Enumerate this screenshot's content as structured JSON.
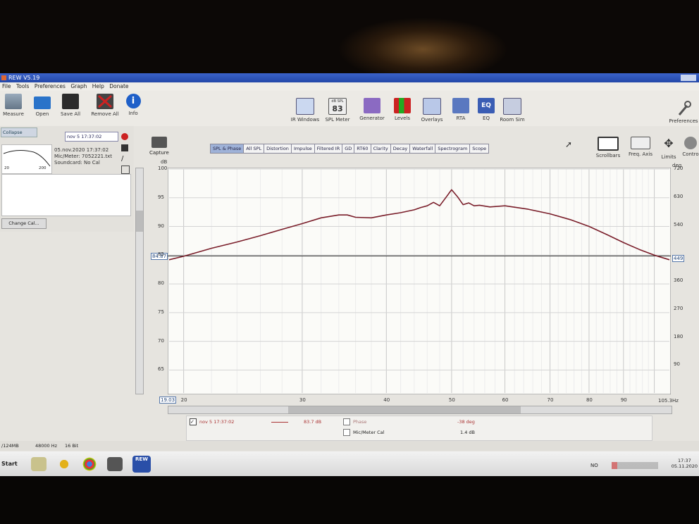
{
  "window": {
    "title": "REW V5.19"
  },
  "menu": [
    "File",
    "Tools",
    "Preferences",
    "Graph",
    "Help",
    "Donate"
  ],
  "toolbar_left": [
    {
      "label": "Measure",
      "icon": "measure-icon"
    },
    {
      "label": "Open",
      "icon": "folder-icon"
    },
    {
      "label": "Save All",
      "icon": "save-icon"
    },
    {
      "label": "Remove All",
      "icon": "remove-icon"
    },
    {
      "label": "Info",
      "icon": "info-icon"
    }
  ],
  "toolbar_center": [
    {
      "label": "IR Windows",
      "icon": "ir-windows-icon"
    },
    {
      "label": "SPL Meter",
      "icon": "spl-meter-icon",
      "badge_top": "dB SPL",
      "badge_value": "83"
    },
    {
      "label": "Generator",
      "icon": "generator-icon"
    },
    {
      "label": "Levels",
      "icon": "levels-icon"
    },
    {
      "label": "Overlays",
      "icon": "overlays-icon"
    },
    {
      "label": "RTA",
      "icon": "rta-icon"
    },
    {
      "label": "EQ",
      "icon": "eq-icon"
    },
    {
      "label": "Room Sim",
      "icon": "room-sim-icon"
    }
  ],
  "toolbar_right": {
    "preferences": "Preferences"
  },
  "left_panel": {
    "collapse": "Collapse",
    "measurement_name": "nov 5 17:37:02",
    "info_lines": [
      "05.nov.2020 17:37:02",
      "Mic/Meter: 7052221.txt",
      "Soundcard: No Cal"
    ],
    "thumb_x": [
      "20",
      "200"
    ],
    "change_cal": "Change Cal..."
  },
  "capture": "Capture",
  "tabs": [
    "SPL & Phase",
    "All SPL",
    "Distortion",
    "Impulse",
    "Filtered IR",
    "GD",
    "RT60",
    "Clarity",
    "Decay",
    "Waterfall",
    "Spectrogram",
    "Scope"
  ],
  "active_tab": "SPL & Phase",
  "graph_tools": [
    {
      "label": "Scrollbars",
      "icon": "scrollbars-icon"
    },
    {
      "label": "Freq. Axis",
      "icon": "freq-axis-icon"
    },
    {
      "label": "Limits",
      "icon": "limits-icon"
    },
    {
      "label": "Contro",
      "icon": "controls-icon"
    }
  ],
  "graph": {
    "y_unit": "dB",
    "y2_unit": "deg",
    "cursor_left": "84.87",
    "cursor_right": "449",
    "x_start": "19.03",
    "x_end": "105.3Hz"
  },
  "chart_data": {
    "type": "line",
    "xlim": [
      19.03,
      105.3
    ],
    "ylim": [
      61,
      100
    ],
    "y2lim": [
      0,
      720
    ],
    "log_x": true,
    "grid": true,
    "x_ticks": [
      20,
      30,
      40,
      50,
      60,
      70,
      80,
      90
    ],
    "y_ticks": [
      65,
      70,
      75,
      80,
      85,
      90,
      95,
      100
    ],
    "y2_ticks": [
      90,
      180,
      270,
      360,
      449,
      540,
      630,
      720
    ],
    "y2_tick_labels": [
      "90",
      "180",
      "270",
      "360",
      "",
      "540",
      "630",
      "720"
    ],
    "cursor_y": 84.87,
    "series": [
      {
        "name": "nov 5 17:37:02",
        "color": "#7a1e2a",
        "x": [
          19.03,
          20,
          22,
          24,
          26,
          28,
          30,
          32,
          34,
          35,
          36,
          38,
          40,
          42,
          44,
          45,
          46,
          47,
          48,
          49,
          50,
          51,
          52,
          53,
          54,
          55,
          57,
          60,
          65,
          70,
          75,
          80,
          85,
          90,
          95,
          100,
          105.3
        ],
        "y": [
          84.2,
          84.8,
          86.2,
          87.3,
          88.4,
          89.5,
          90.5,
          91.5,
          92.0,
          92.0,
          91.6,
          91.5,
          92.0,
          92.4,
          92.9,
          93.3,
          93.6,
          94.2,
          93.6,
          95.0,
          96.4,
          95.2,
          93.8,
          94.1,
          93.6,
          93.7,
          93.4,
          93.6,
          93.0,
          92.2,
          91.2,
          90.0,
          88.6,
          87.2,
          86.0,
          85.0,
          84.2
        ]
      }
    ]
  },
  "legend": {
    "name": "nov 5 17:37:02",
    "value": "83.7 dB",
    "phase_label": "Phase",
    "phase_value": "-38 deg",
    "mic_cal_label": "Mic/Meter Cal",
    "mic_cal_value": "1.4 dB"
  },
  "status": {
    "memory": "/124MB",
    "rate": "48000 Hz",
    "bits": "16 Bit"
  },
  "taskbar": {
    "start": "Start",
    "rew_badge": "REW",
    "lang": "NO",
    "time": "17:37",
    "date": "05.11.2020"
  }
}
